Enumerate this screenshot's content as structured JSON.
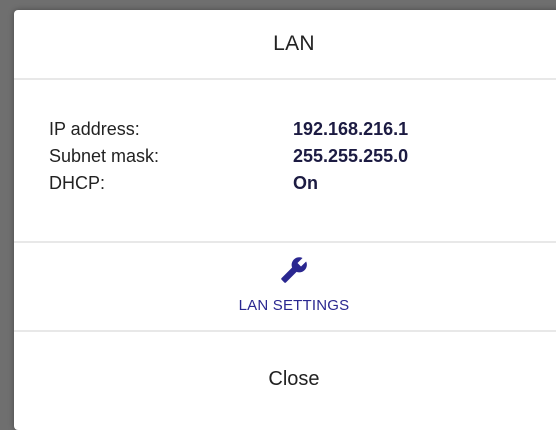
{
  "dialog": {
    "title": "LAN",
    "info": [
      {
        "label": "IP address:",
        "value": "192.168.216.1"
      },
      {
        "label": "Subnet mask:",
        "value": "255.255.255.0"
      },
      {
        "label": "DHCP:",
        "value": "On"
      }
    ],
    "settings_label": "LAN SETTINGS",
    "settings_icon": "wrench-icon",
    "close_label": "Close"
  },
  "colors": {
    "accent": "#2a2790",
    "value_text": "#1c1b42",
    "backdrop": "#6f6f6f",
    "divider": "#e8e8e8"
  }
}
